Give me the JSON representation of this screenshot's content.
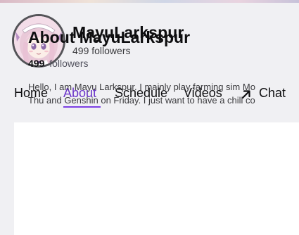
{
  "channel": {
    "name": "MayuLarkspur",
    "followers_text": "499 followers"
  },
  "tabs": [
    {
      "label": "Home",
      "active": false
    },
    {
      "label": "About",
      "active": true
    },
    {
      "label": "Schedule",
      "active": false
    },
    {
      "label": "Videos",
      "active": false
    }
  ],
  "chat_tab": {
    "label": "Chat",
    "icon": "arrow-up-right-icon"
  },
  "about": {
    "title": "About MayuLarkspur",
    "follower_count": "499",
    "follower_label": "followers",
    "bio_lines": [
      "Hello, I am Mayu Larkspur. I mainly play farming sim Mo",
      "Thu and Genshin on Friday. I just want to have a chill co"
    ]
  },
  "colors": {
    "accent": "#7b3fe4",
    "active_tab_text": "#6b35c9",
    "background": "#f0f0f3",
    "card": "#ffffff"
  }
}
